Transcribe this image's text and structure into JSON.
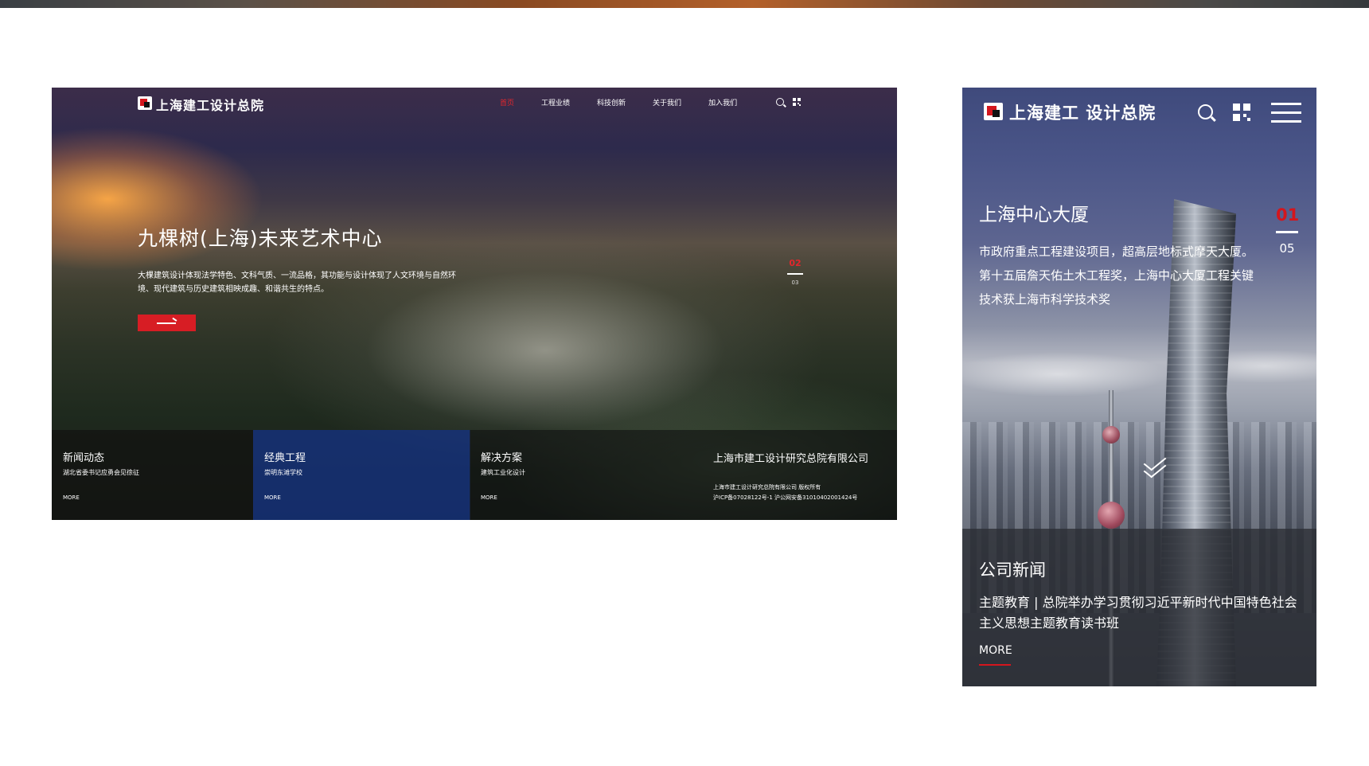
{
  "desktop": {
    "logo_text": "上海建工设计总院",
    "nav": {
      "items": [
        {
          "label": "首页",
          "active": true
        },
        {
          "label": "工程业绩",
          "active": false
        },
        {
          "label": "科技创新",
          "active": false
        },
        {
          "label": "关于我们",
          "active": false
        },
        {
          "label": "加入我们",
          "active": false
        }
      ]
    },
    "hero": {
      "title": "九棵树(上海)未来艺术中心",
      "description": "大棵建筑设计体现法学特色、文科气质、一流品格，其功能与设计体现了人文环境与自然环境、现代建筑与历史建筑相映成趣、和谐共生的特点。",
      "pager_current": "02",
      "pager_total": "03"
    },
    "panels": [
      {
        "title": "新闻动态",
        "subtitle": "湖北省委书记应勇会见徐征",
        "more": "MORE"
      },
      {
        "title": "经典工程",
        "subtitle": "崇明东滩学校",
        "more": "MORE"
      },
      {
        "title": "解决方案",
        "subtitle": "建筑工业化设计",
        "more": "MORE"
      }
    ],
    "company_name": "上海市建工设计研究总院有限公司",
    "footnote_line1": "上海市建工设计研究总院有限公司 版权所有",
    "footnote_line2": "沪ICP备07028122号-1 沪公网安备31010402001424号"
  },
  "mobile": {
    "logo_text": "上海建工 设计总院",
    "hero": {
      "title": "上海中心大厦",
      "description": "市政府重点工程建设项目，超高层地标式摩天大厦。第十五届詹天佑土木工程奖，上海中心大厦工程关键技术获上海市科学技术奖",
      "pager_current": "01",
      "pager_total": "05"
    },
    "news": {
      "title": "公司新闻",
      "text": "主题教育 | 总院举办学习贯彻习近平新时代中国特色社会主义思想主题教育读书班",
      "more": "MORE"
    }
  },
  "colors": {
    "accent_red": "#d4161d",
    "panel_blue": "#14328a"
  }
}
